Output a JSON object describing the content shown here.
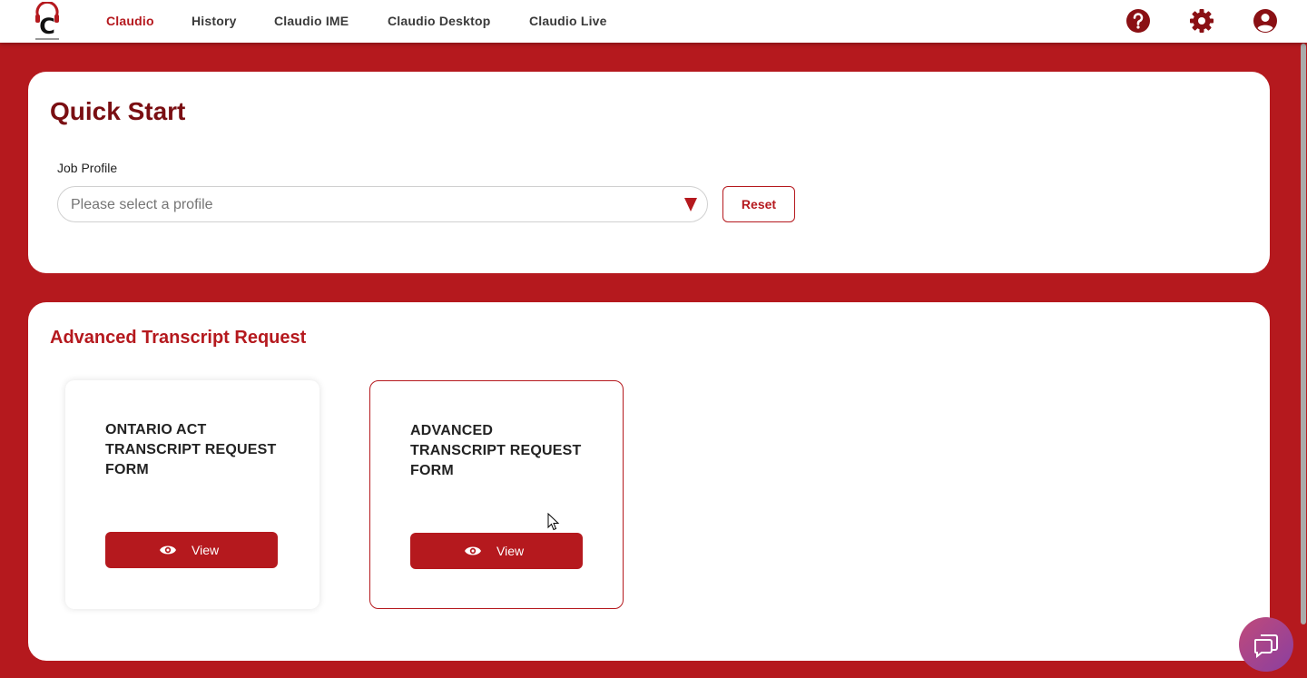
{
  "nav": {
    "logo_alt": "C",
    "items": [
      {
        "label": "Claudio",
        "active": true
      },
      {
        "label": "History",
        "active": false
      },
      {
        "label": "Claudio IME",
        "active": false
      },
      {
        "label": "Claudio Desktop",
        "active": false
      },
      {
        "label": "Claudio Live",
        "active": false
      }
    ],
    "icons": [
      "help-icon",
      "settings-gear-icon",
      "account-icon"
    ]
  },
  "quick_start": {
    "title": "Quick Start",
    "job_profile_label": "Job Profile",
    "job_profile_placeholder": "Please select a profile",
    "reset_label": "Reset"
  },
  "advanced": {
    "title": "Advanced Transcript Request",
    "forms": [
      {
        "title": "ONTARIO ACT TRANSCRIPT REQUEST FORM",
        "button_label": "View"
      },
      {
        "title": "ADVANCED TRANSCRIPT REQUEST FORM",
        "button_label": "View"
      }
    ]
  },
  "colors": {
    "brand_red": "#b5191e",
    "dark_red": "#7a0e12",
    "chat_gradient_start": "#c04a7a",
    "chat_gradient_end": "#8a3fa0"
  }
}
